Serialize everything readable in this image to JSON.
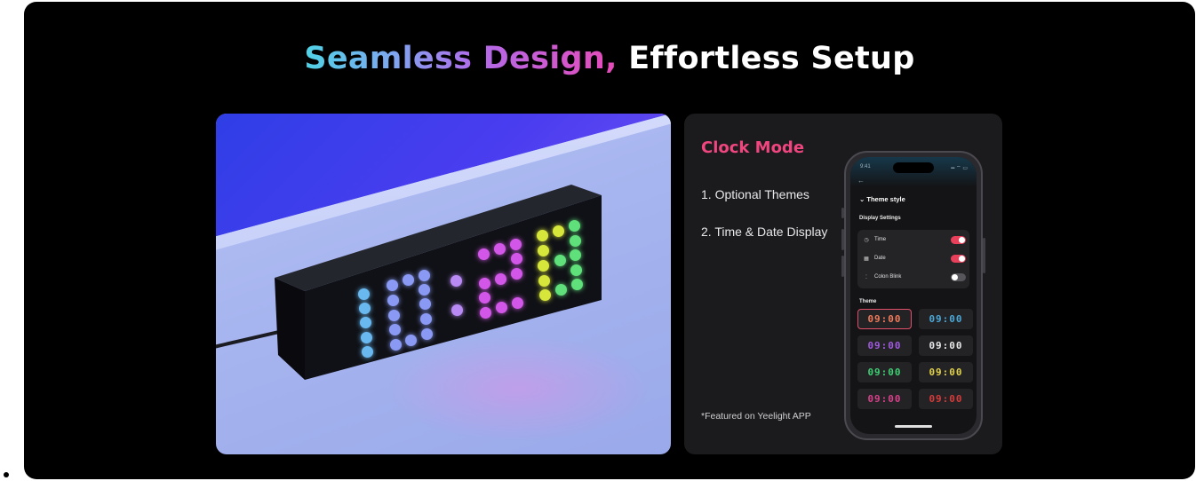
{
  "headline": {
    "gradient_part": "Seamless Design,",
    "plain_part": "Effortless Setup"
  },
  "card": {
    "title": "Clock Mode",
    "features": [
      "1. Optional Themes",
      "2. Time & Date Display"
    ],
    "footnote": "*Featured on Yeelight APP"
  },
  "phone": {
    "status_time": "9:41",
    "status_right": "▪▪ ⌔ ▭",
    "back_icon": "back-arrow-icon",
    "theme_style_label": "Theme style",
    "display_settings_label": "Display Settings",
    "settings": [
      {
        "icon": "clock-icon",
        "label": "Time",
        "on": true
      },
      {
        "icon": "calendar-icon",
        "label": "Date",
        "on": true
      },
      {
        "icon": "colon-icon",
        "label": "Colon Blink",
        "on": false
      }
    ],
    "theme_label": "Theme",
    "themes": [
      {
        "text": "09:00",
        "color": "#f07a5a",
        "selected": true
      },
      {
        "text": "09:00",
        "color": "#4aa8d8",
        "selected": false
      },
      {
        "text": "09:00",
        "color": "#a05ae0",
        "selected": false
      },
      {
        "text": "09:00",
        "color": "#e8e8e8",
        "selected": false
      },
      {
        "text": "09:00",
        "color": "#3fcf73",
        "selected": false
      },
      {
        "text": "09:00",
        "color": "#e2d24a",
        "selected": false
      },
      {
        "text": "09:00",
        "color": "#d8408a",
        "selected": false
      },
      {
        "text": "09:00",
        "color": "#d83a3a",
        "selected": false
      }
    ]
  },
  "colors": {
    "accent_pink": "#f0467f",
    "toggle_on": "#e8405a",
    "toggle_off": "#55555a"
  }
}
